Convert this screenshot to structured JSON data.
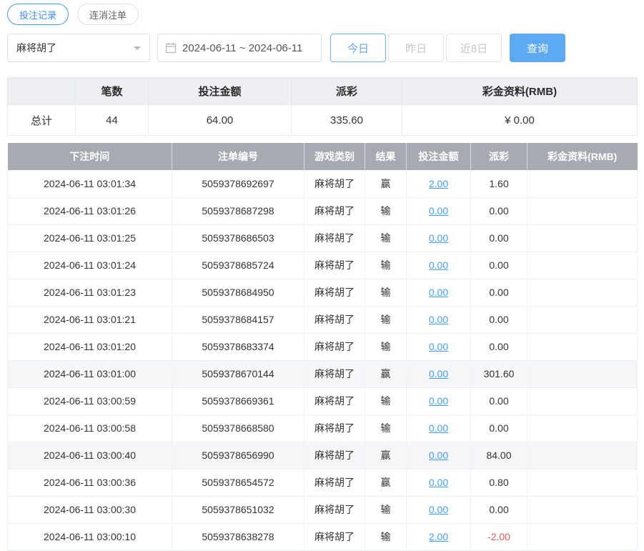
{
  "colors": {
    "accent_blue": "#409eff",
    "header_gray": "#a7aab1",
    "negative_red": "#f0544f",
    "query_button": "#5da9f2"
  },
  "tabs": [
    {
      "label": "投注记录",
      "active": true
    },
    {
      "label": "连消注单",
      "active": false
    }
  ],
  "filters": {
    "game_select": "麻将胡了",
    "date_range": "2024-06-11 ~ 2024-06-11",
    "quick_buttons": [
      {
        "label": "今日",
        "active": true
      },
      {
        "label": "昨日",
        "active": false
      },
      {
        "label": "近8日",
        "active": false
      }
    ],
    "query_label": "查询"
  },
  "summary": {
    "headers": [
      "",
      "笔数",
      "投注金额",
      "派彩",
      "彩金资料(RMB)"
    ],
    "row": {
      "label": "总计",
      "count": "44",
      "bet": "64.00",
      "payout": "335.60",
      "jackpot": "¥ 0.00"
    }
  },
  "table": {
    "headers": [
      "下注时间",
      "注单编号",
      "游戏类别",
      "结果",
      "投注金额",
      "派彩",
      "彩金资料(RMB)"
    ],
    "rows": [
      {
        "time": "2024-06-11 03:01:34",
        "order": "5059378692697",
        "game": "麻将胡了",
        "result": "赢",
        "bet": "2.00",
        "payout": "1.60",
        "jackpot": "",
        "hl": false
      },
      {
        "time": "2024-06-11 03:01:26",
        "order": "5059378687298",
        "game": "麻将胡了",
        "result": "输",
        "bet": "0.00",
        "payout": "0.00",
        "jackpot": "",
        "hl": false
      },
      {
        "time": "2024-06-11 03:01:25",
        "order": "5059378686503",
        "game": "麻将胡了",
        "result": "输",
        "bet": "0.00",
        "payout": "0.00",
        "jackpot": "",
        "hl": false
      },
      {
        "time": "2024-06-11 03:01:24",
        "order": "5059378685724",
        "game": "麻将胡了",
        "result": "输",
        "bet": "0.00",
        "payout": "0.00",
        "jackpot": "",
        "hl": false
      },
      {
        "time": "2024-06-11 03:01:23",
        "order": "5059378684950",
        "game": "麻将胡了",
        "result": "输",
        "bet": "0.00",
        "payout": "0.00",
        "jackpot": "",
        "hl": false
      },
      {
        "time": "2024-06-11 03:01:21",
        "order": "5059378684157",
        "game": "麻将胡了",
        "result": "输",
        "bet": "0.00",
        "payout": "0.00",
        "jackpot": "",
        "hl": false
      },
      {
        "time": "2024-06-11 03:01:20",
        "order": "5059378683374",
        "game": "麻将胡了",
        "result": "输",
        "bet": "0.00",
        "payout": "0.00",
        "jackpot": "",
        "hl": false
      },
      {
        "time": "2024-06-11 03:01:00",
        "order": "5059378670144",
        "game": "麻将胡了",
        "result": "赢",
        "bet": "0.00",
        "payout": "301.60",
        "jackpot": "",
        "hl": true
      },
      {
        "time": "2024-06-11 03:00:59",
        "order": "5059378669361",
        "game": "麻将胡了",
        "result": "输",
        "bet": "0.00",
        "payout": "0.00",
        "jackpot": "",
        "hl": false
      },
      {
        "time": "2024-06-11 03:00:58",
        "order": "5059378668580",
        "game": "麻将胡了",
        "result": "输",
        "bet": "0.00",
        "payout": "0.00",
        "jackpot": "",
        "hl": false
      },
      {
        "time": "2024-06-11 03:00:40",
        "order": "5059378656990",
        "game": "麻将胡了",
        "result": "赢",
        "bet": "0.00",
        "payout": "84.00",
        "jackpot": "",
        "hl": true
      },
      {
        "time": "2024-06-11 03:00:36",
        "order": "5059378654572",
        "game": "麻将胡了",
        "result": "赢",
        "bet": "0.00",
        "payout": "0.80",
        "jackpot": "",
        "hl": false
      },
      {
        "time": "2024-06-11 03:00:30",
        "order": "5059378651032",
        "game": "麻将胡了",
        "result": "输",
        "bet": "0.00",
        "payout": "0.00",
        "jackpot": "",
        "hl": false
      },
      {
        "time": "2024-06-11 03:00:10",
        "order": "5059378638278",
        "game": "麻将胡了",
        "result": "输",
        "bet": "2.00",
        "payout": "-2.00",
        "jackpot": "",
        "hl": false
      }
    ]
  }
}
